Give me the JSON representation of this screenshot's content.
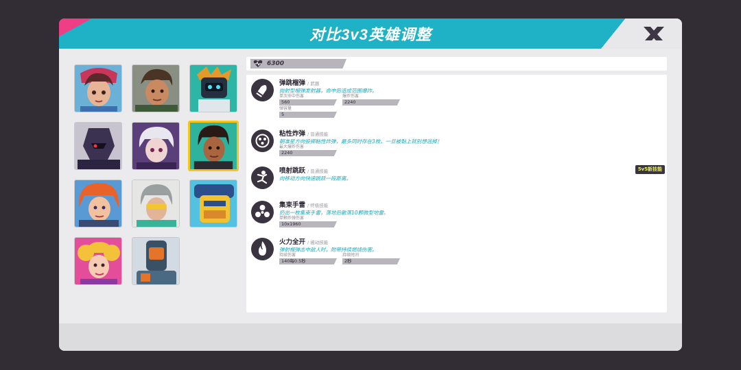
{
  "title": "对比3v3英雄调整",
  "hp": "6300",
  "colors": {
    "header": "#1fb2c6",
    "accent_pink": "#ee3f86",
    "selected": "#f5c41f",
    "skill_desc": "#1aa8bc"
  },
  "heroes": [
    {
      "name": "hero-1"
    },
    {
      "name": "hero-2"
    },
    {
      "name": "hero-3"
    },
    {
      "name": "hero-4"
    },
    {
      "name": "hero-5"
    },
    {
      "name": "hero-6",
      "selected": true
    },
    {
      "name": "hero-7"
    },
    {
      "name": "hero-8"
    },
    {
      "name": "hero-9"
    },
    {
      "name": "hero-10"
    },
    {
      "name": "hero-11"
    }
  ],
  "skills": [
    {
      "name": "弹跳榴弹",
      "type": "/ 武器",
      "desc": "抛射型榴弹发射器，命中后造成范围爆炸。",
      "icon": "bullet-icon",
      "stats": [
        {
          "label": "单次命中伤害",
          "value": "560"
        },
        {
          "label": "爆炸伤害",
          "value": "2240"
        },
        {
          "label": "弹容量",
          "value": "5"
        }
      ]
    },
    {
      "name": "粘性炸弹",
      "type": "/ 普通技能",
      "desc": "朝准星方向投掷粘性炸弹，最多同时存在3枚。一旦被黏上就别想逃掉！",
      "icon": "sticky-bomb-icon",
      "stats": [
        {
          "label": "最大爆炸伤害",
          "value": "2240"
        }
      ]
    },
    {
      "name": "喷射跳跃",
      "type": "/ 普通技能",
      "desc": "向移动方向快速跳跃一段距离。",
      "icon": "jump-icon",
      "badge": "5v5新技能",
      "stats": []
    },
    {
      "name": "集束手雷",
      "type": "/ 终极技能",
      "desc": "扔出一枚集束手雷，落地后散落10颗微型地雷。",
      "icon": "cluster-grenade-icon",
      "stats": [
        {
          "label": "单颗炸弹伤害",
          "value": "10x1960"
        }
      ]
    },
    {
      "name": "火力全开",
      "type": "/ 被动技能",
      "desc": "弹射榴弹击中敌人时，附带持续燃烧伤害。",
      "icon": "fire-icon",
      "stats": [
        {
          "label": "持续伤害",
          "value": "140每0.5秒"
        },
        {
          "label": "持续时间",
          "value": "2秒"
        }
      ]
    }
  ]
}
